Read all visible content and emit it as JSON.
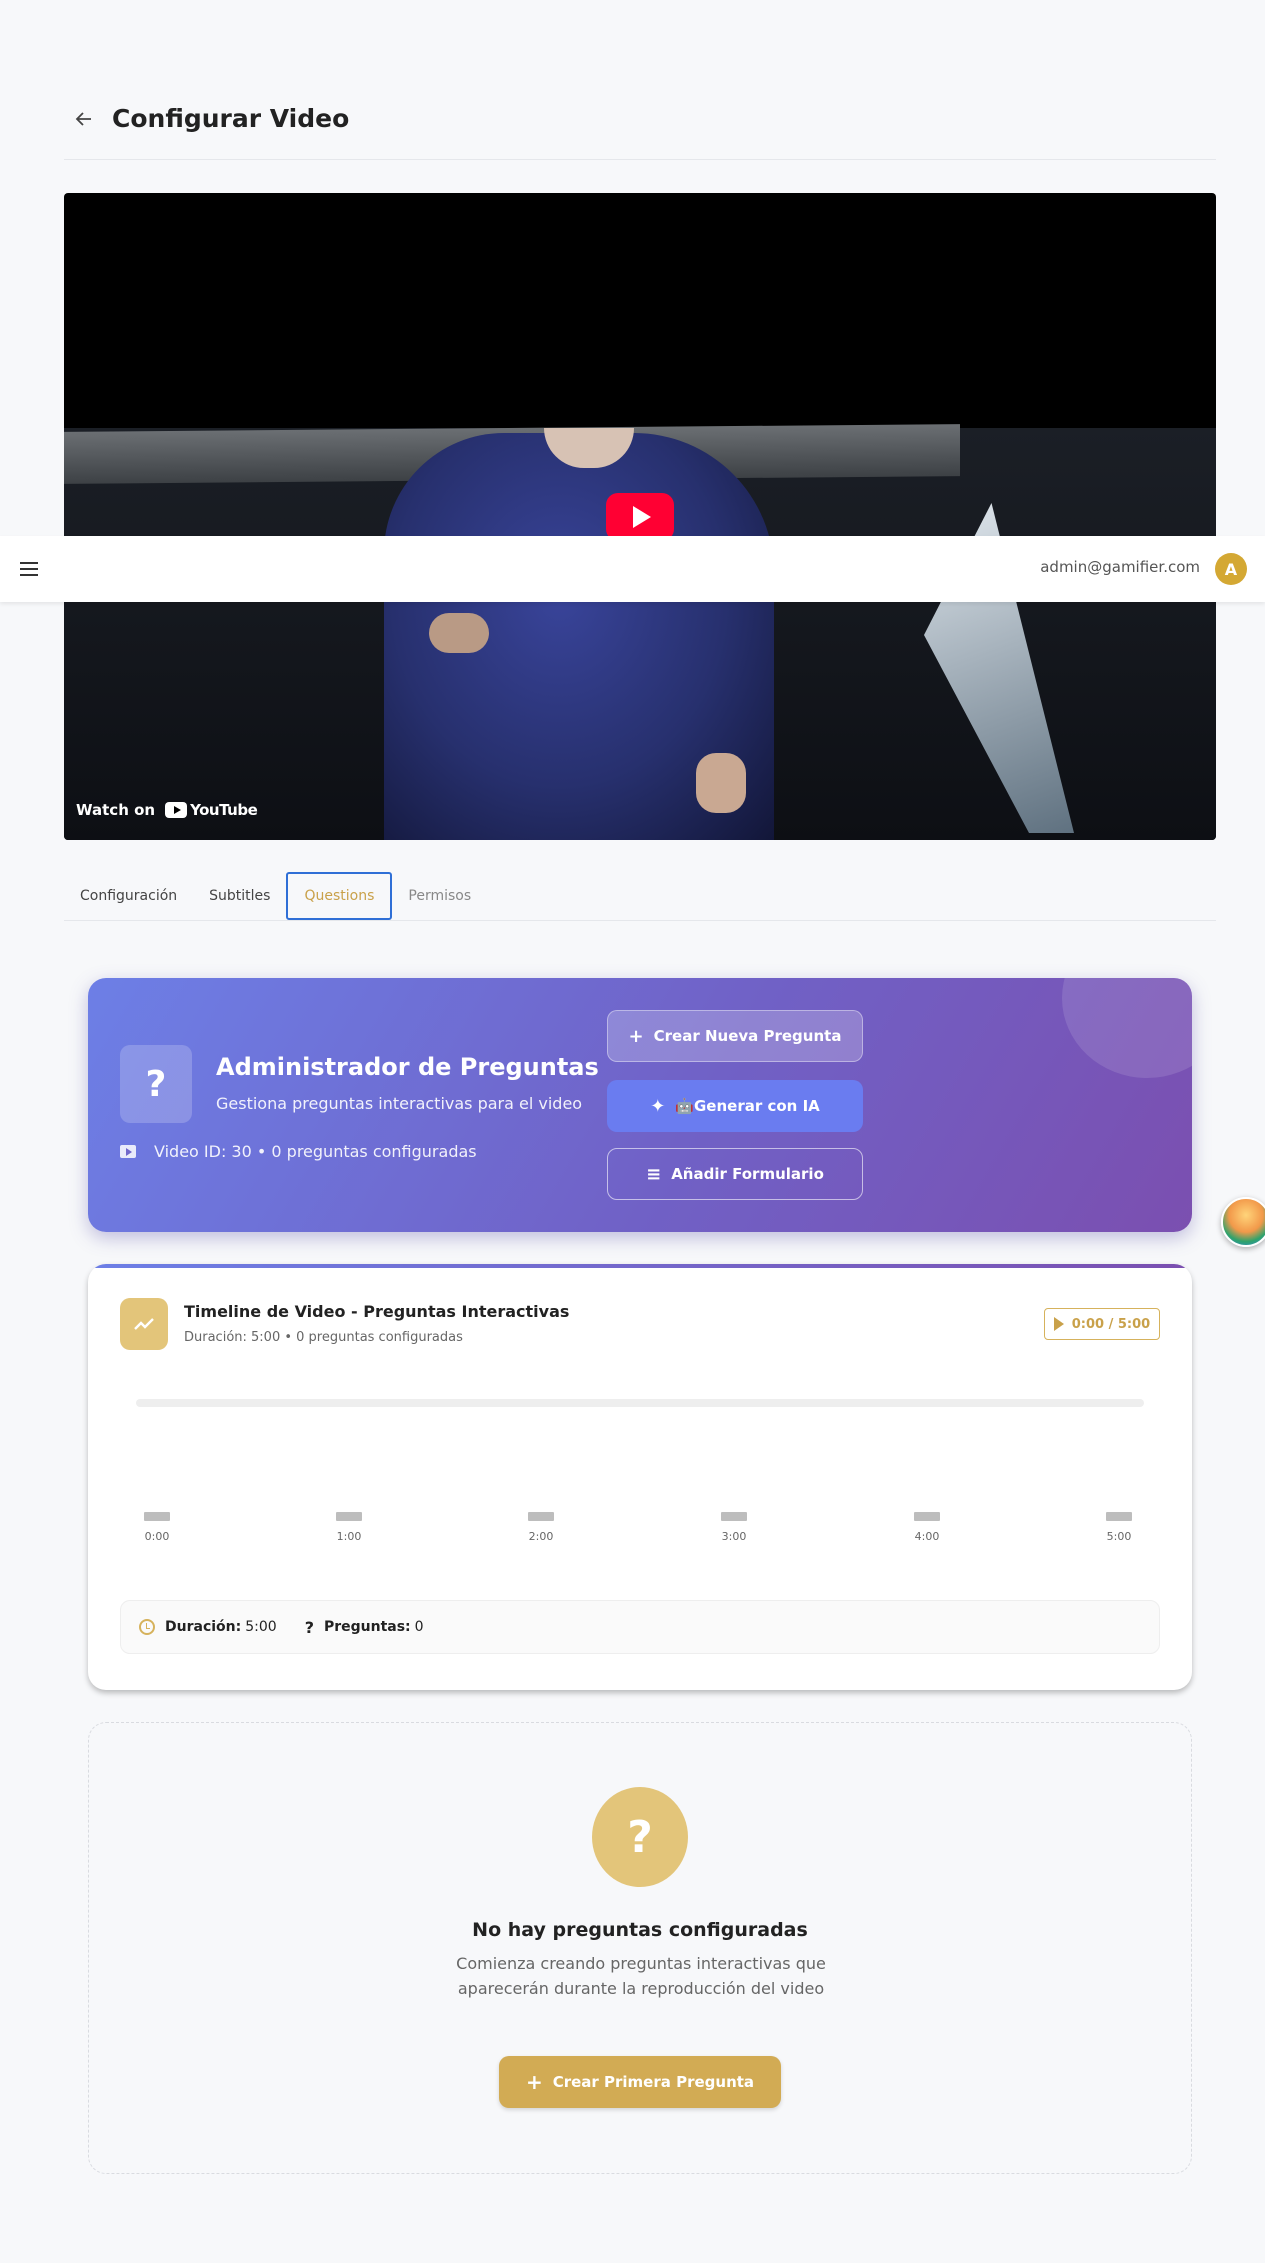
{
  "header": {
    "title": "Configurar Video"
  },
  "video": {
    "watch_on": "Watch on",
    "youtube_label": "YouTube"
  },
  "topbar": {
    "user_email": "admin@gamifier.com",
    "avatar_initial": "A"
  },
  "tabs": [
    {
      "label": "Configuración"
    },
    {
      "label": "Subtitles"
    },
    {
      "label": "Questions",
      "active": true
    },
    {
      "label": "Permisos"
    }
  ],
  "hero": {
    "title": "Administrador de Preguntas",
    "subtitle": "Gestiona preguntas interactivas para el video",
    "meta": "Video ID: 30 • 0 preguntas configuradas",
    "buttons": {
      "new_question": "Crear Nueva Pregunta",
      "generate_ai": "🤖Generar con IA",
      "add_form": "Añadir Formulario"
    }
  },
  "timeline": {
    "title": "Timeline de Video - Preguntas Interactivas",
    "subtitle": "Duración: 5:00 • 0 preguntas configuradas",
    "time_chip": "0:00 / 5:00",
    "ticks": [
      "0:00",
      "1:00",
      "2:00",
      "3:00",
      "4:00",
      "5:00"
    ],
    "stats": {
      "duration_label": "Duración:",
      "duration_value": "5:00",
      "questions_label": "Preguntas:",
      "questions_value": "0"
    }
  },
  "empty_state": {
    "title": "No hay preguntas configuradas",
    "subtitle": "Comienza creando preguntas interactivas que aparecerán durante la reproducción del video",
    "button": "Crear Primera Pregunta"
  },
  "colors": {
    "accent": "#c9a14a",
    "hero_start": "#6d7fe6",
    "hero_end": "#7b4fb0",
    "youtube_red": "#ff0033"
  }
}
